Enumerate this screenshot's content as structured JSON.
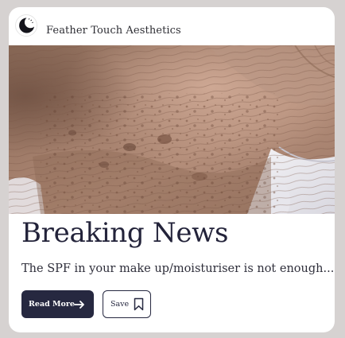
{
  "header": {
    "brand_name": "Feather Touch Aesthetics",
    "logo_icon": "crescent-moon-icon"
  },
  "article": {
    "title": "Breaking News",
    "excerpt": "The SPF in your make up/moisturiser is not enough....",
    "image_subject": "close-up-of-sun-damaged-neck-skin"
  },
  "actions": {
    "read_more_label": "Read More",
    "read_more_icon": "arrow-right-icon",
    "save_label": "Save",
    "save_icon": "bookmark-icon"
  },
  "colors": {
    "page_background": "#d6d2d1",
    "card_background": "#ffffff",
    "primary_button": "#262840",
    "text": "#23233a"
  }
}
